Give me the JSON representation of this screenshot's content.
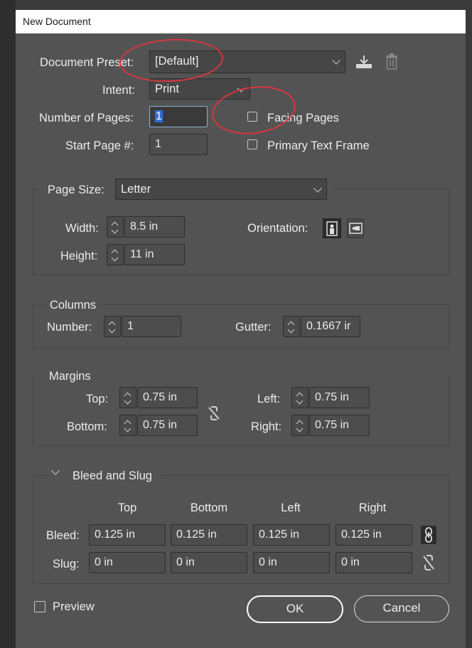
{
  "window": {
    "title": "New Document"
  },
  "preset": {
    "label": "Document Preset:",
    "value": "[Default]",
    "save_icon": "save-preset-icon",
    "delete_icon": "trash-icon"
  },
  "intent": {
    "label": "Intent:",
    "value": "Print"
  },
  "pages": {
    "label": "Number of Pages:",
    "value": "1",
    "facing_label": "Facing Pages",
    "facing_checked": false
  },
  "start_page": {
    "label": "Start Page #:",
    "value": "1",
    "primary_label": "Primary Text Frame",
    "primary_checked": false
  },
  "page_size": {
    "label": "Page Size:",
    "value": "Letter",
    "width_label": "Width:",
    "width": "8.5 in",
    "height_label": "Height:",
    "height": "11 in",
    "orientation_label": "Orientation:"
  },
  "columns": {
    "title": "Columns",
    "number_label": "Number:",
    "number": "1",
    "gutter_label": "Gutter:",
    "gutter": "0.1667 ir"
  },
  "margins": {
    "title": "Margins",
    "top_label": "Top:",
    "top": "0.75 in",
    "bottom_label": "Bottom:",
    "bottom": "0.75 in",
    "left_label": "Left:",
    "left": "0.75 in",
    "right_label": "Right:",
    "right": "0.75 in"
  },
  "bleed_slug": {
    "title": "Bleed and Slug",
    "headers": [
      "Top",
      "Bottom",
      "Left",
      "Right"
    ],
    "bleed_label": "Bleed:",
    "bleed": [
      "0.125 in",
      "0.125 in",
      "0.125 in",
      "0.125 in"
    ],
    "slug_label": "Slug:",
    "slug": [
      "0 in",
      "0 in",
      "0 in",
      "0 in"
    ]
  },
  "footer": {
    "preview_label": "Preview",
    "preview_checked": false,
    "ok_label": "OK",
    "cancel_label": "Cancel"
  },
  "colors": {
    "dialog_bg": "#535353",
    "field_bg": "#444444",
    "annotation": "#d9363e",
    "title_bar": "#ffffff"
  }
}
